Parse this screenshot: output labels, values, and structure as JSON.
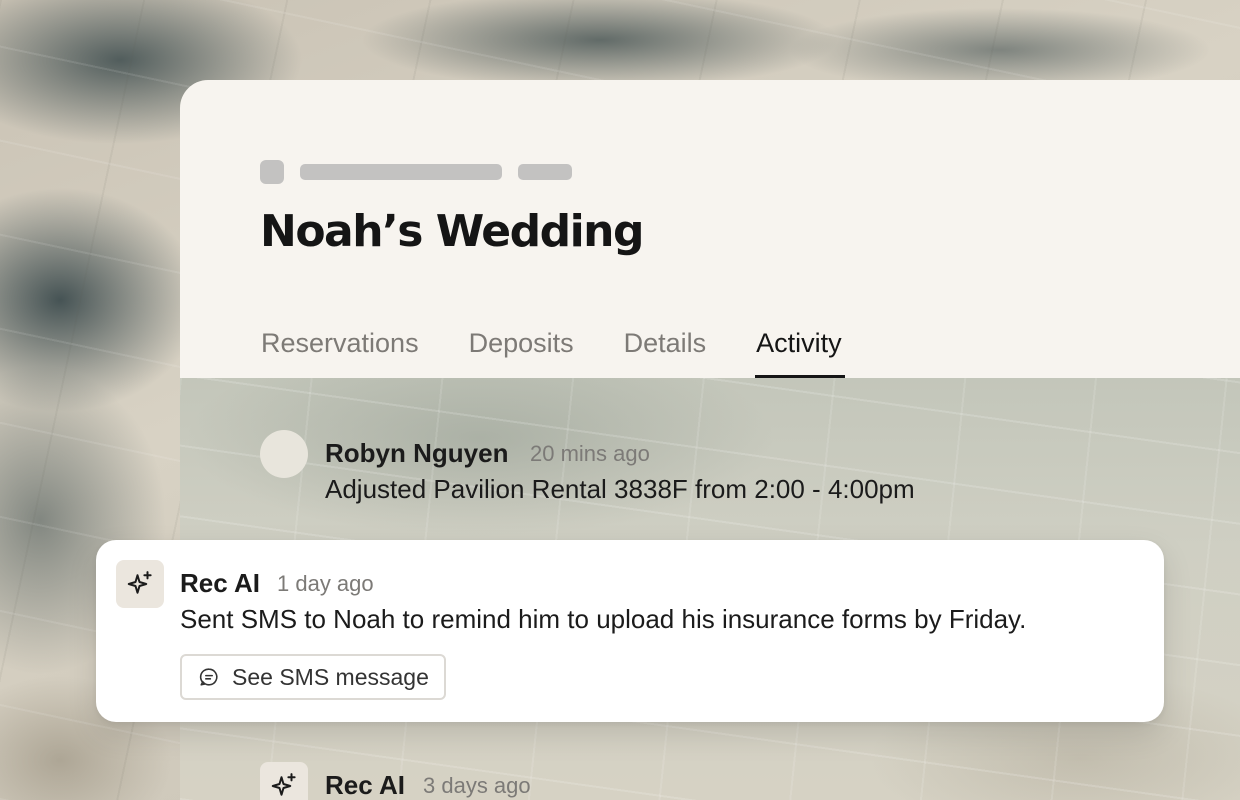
{
  "event": {
    "title": "Noah’s Wedding"
  },
  "tabs": [
    {
      "label": "Reservations",
      "active": false
    },
    {
      "label": "Deposits",
      "active": false
    },
    {
      "label": "Details",
      "active": false
    },
    {
      "label": "Activity",
      "active": true
    }
  ],
  "activity": [
    {
      "author": "Robyn Nguyen",
      "time": "20 mins ago",
      "message": "Adjusted Pavilion Rental 3838F from 2:00 - 4:00pm",
      "icon": "avatar"
    },
    {
      "author": "Rec AI",
      "time": "1 day ago",
      "message": "Sent SMS to Noah to remind him to upload his insurance forms by Friday.",
      "icon": "sparkle-icon",
      "action_label": "See SMS message",
      "action_icon": "chat-bubble-icon"
    },
    {
      "author": "Rec AI",
      "time": "3 days ago",
      "icon": "sparkle-icon"
    }
  ],
  "colors": {
    "header_bg": "#f7f4ef",
    "text_primary": "#151515",
    "text_muted": "#7d7a76",
    "icon_box_bg": "#ebe6de",
    "skeleton": "#c3c2c1"
  }
}
